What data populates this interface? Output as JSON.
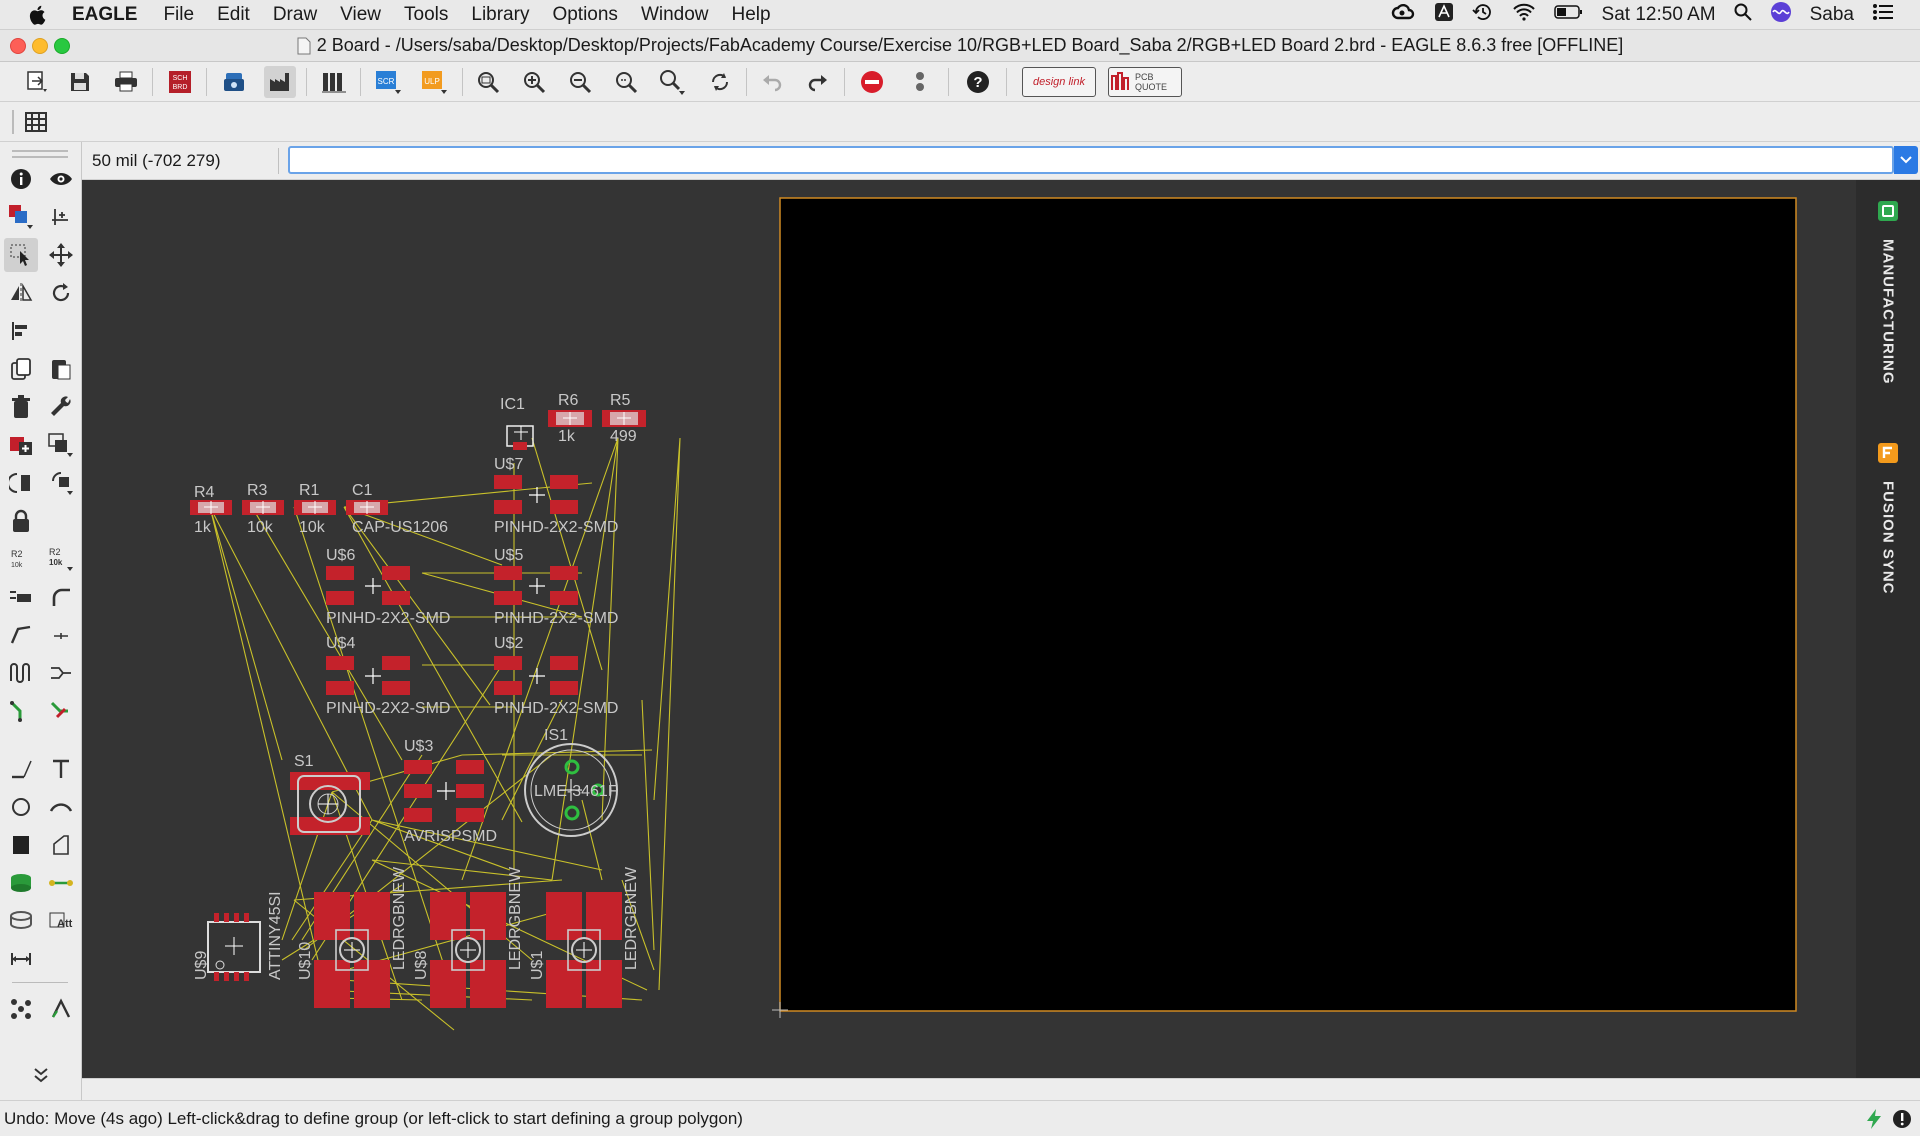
{
  "menubar": {
    "app_name": "EAGLE",
    "items": [
      "File",
      "Edit",
      "Draw",
      "View",
      "Tools",
      "Library",
      "Options",
      "Window",
      "Help"
    ],
    "clock": "Sat 12:50 AM",
    "user": "Saba"
  },
  "window": {
    "title": "2 Board - /Users/saba/Desktop/Desktop/Projects/FabAcademy Course/Exercise 10/RGB+LED Board_Saba 2/RGB+LED Board 2.brd - EAGLE 8.6.3 free [OFFLINE]"
  },
  "toolbar": {
    "sch_brd_label": "SCH BRD",
    "scr_label": "SCR",
    "ulp_label": "ULP",
    "design_link_label": "design link",
    "pcb_quote_label": "PCB QUOTE"
  },
  "command": {
    "grid_coord": "50 mil (-702 279)",
    "input_value": ""
  },
  "right_panel": {
    "manufacturing_label": "MANUFACTURING",
    "fusion_sync_label": "FUSION SYNC"
  },
  "board": {
    "colors": {
      "background": "#343434",
      "board": "#000000",
      "outline": "#d08a22",
      "pad": "#c4222b",
      "airwire": "#c9c12a",
      "text": "#c8c8c8",
      "via": "#2fbf40"
    },
    "parts": [
      {
        "name": "IC1",
        "value": ""
      },
      {
        "name": "R6",
        "value": "1k"
      },
      {
        "name": "R5",
        "value": "499"
      },
      {
        "name": "R4",
        "value": "1k"
      },
      {
        "name": "R3",
        "value": "10k"
      },
      {
        "name": "R1",
        "value": "10k"
      },
      {
        "name": "C1",
        "value": "CAP-US1206"
      },
      {
        "name": "U$7",
        "value": "PINHD-2X2-SMD"
      },
      {
        "name": "U$6",
        "value": "PINHD-2X2-SMD"
      },
      {
        "name": "U$5",
        "value": "PINHD-2X2-SMD"
      },
      {
        "name": "U$4",
        "value": "PINHD-2X2-SMD"
      },
      {
        "name": "U$2",
        "value": "PINHD-2X2-SMD"
      },
      {
        "name": "S1",
        "value": ""
      },
      {
        "name": "U$3",
        "value": "AVRISPSMD"
      },
      {
        "name": "IS1",
        "value": "LME-3461F"
      },
      {
        "name": "U$9",
        "value": "ATTINY45SI"
      },
      {
        "name": "U$10",
        "value": "LEDRGBNEW"
      },
      {
        "name": "U$8",
        "value": "LEDRGBNEW"
      },
      {
        "name": "U$1",
        "value": "LEDRGBNEW"
      }
    ]
  },
  "status": {
    "message": "Undo: Move (4s ago) Left-click&drag to define group (or left-click to start defining a group polygon)"
  },
  "icons": [
    "apple-icon",
    "creative-cloud-icon",
    "acrobat-icon",
    "time-machine-icon",
    "wifi-icon",
    "battery-icon",
    "spotlight-icon",
    "siri-icon",
    "control-center-icon"
  ]
}
